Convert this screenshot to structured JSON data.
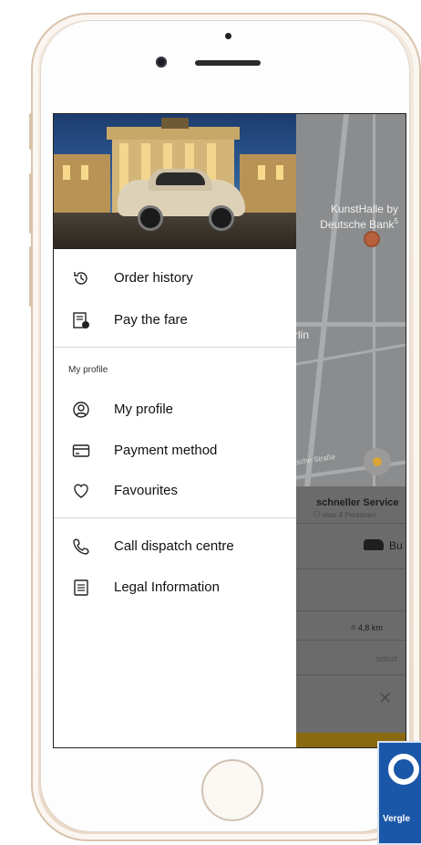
{
  "drawer": {
    "items_top": [
      {
        "label": "Order history",
        "icon": "history-icon"
      },
      {
        "label": "Pay the fare",
        "icon": "receipt-icon"
      }
    ],
    "section_label": "My profile",
    "items_profile": [
      {
        "label": "My profile",
        "icon": "profile-icon"
      },
      {
        "label": "Payment method",
        "icon": "credit-card-icon"
      },
      {
        "label": "Favourites",
        "icon": "heart-icon"
      }
    ],
    "items_bottom": [
      {
        "label": "Call dispatch centre",
        "icon": "phone-icon"
      },
      {
        "label": "Legal Information",
        "icon": "document-icon"
      }
    ]
  },
  "map": {
    "poi_label": "KunstHalle by Deutsche Bank",
    "poi_superscript": "5",
    "partial_label": "rlin",
    "street": "sche Straße"
  },
  "booking_panel": {
    "service_title": "schneller Service",
    "service_capacity": "max 4 Personen",
    "vehicle_label": "Bu",
    "distance": "4,8 km",
    "time": "sofort"
  },
  "badge": {
    "text": "Vergle"
  }
}
